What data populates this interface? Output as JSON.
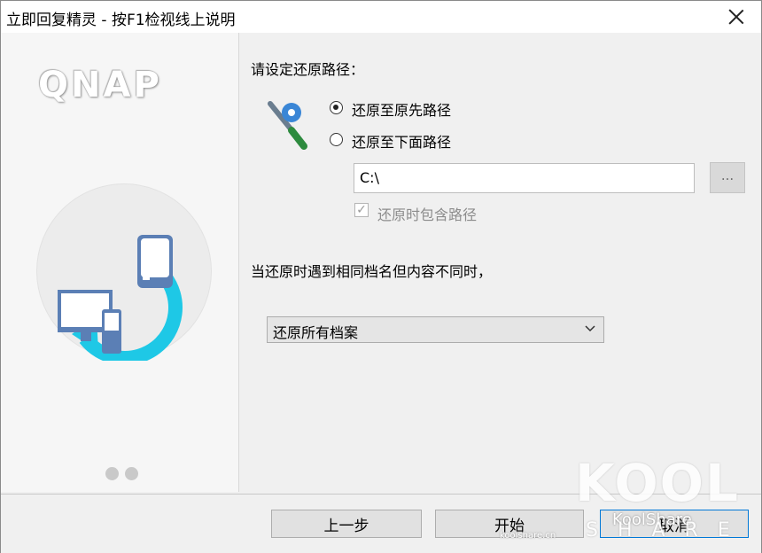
{
  "window": {
    "title": "立即回复精灵 - 按F1检视线上说明"
  },
  "sidebar": {
    "logo_text": "QNAP"
  },
  "main": {
    "heading": "请设定还原路径：",
    "radio_original": "还原至原先路径",
    "radio_below": "还原至下面路径",
    "path_value": "C:\\",
    "browse_label": "...",
    "include_path_label": "还原时包含路径",
    "conflict_question": "当还原时遇到相同档名但内容不同时，",
    "conflict_selected": "还原所有档案"
  },
  "footer": {
    "back_label": "上一步",
    "start_label": "开始",
    "cancel_label": "取消"
  },
  "watermark": {
    "brand": "KoolShare",
    "kool": "KOOL",
    "share": "SHARE",
    "url": "koolshare.cn"
  },
  "colors": {
    "accent": "#0078d7",
    "cyan_arrow": "#1ec8e6",
    "device_blue": "#4a6fa5"
  },
  "state": {
    "selected_radio": "original",
    "include_path_checked": true,
    "include_path_disabled": true
  }
}
